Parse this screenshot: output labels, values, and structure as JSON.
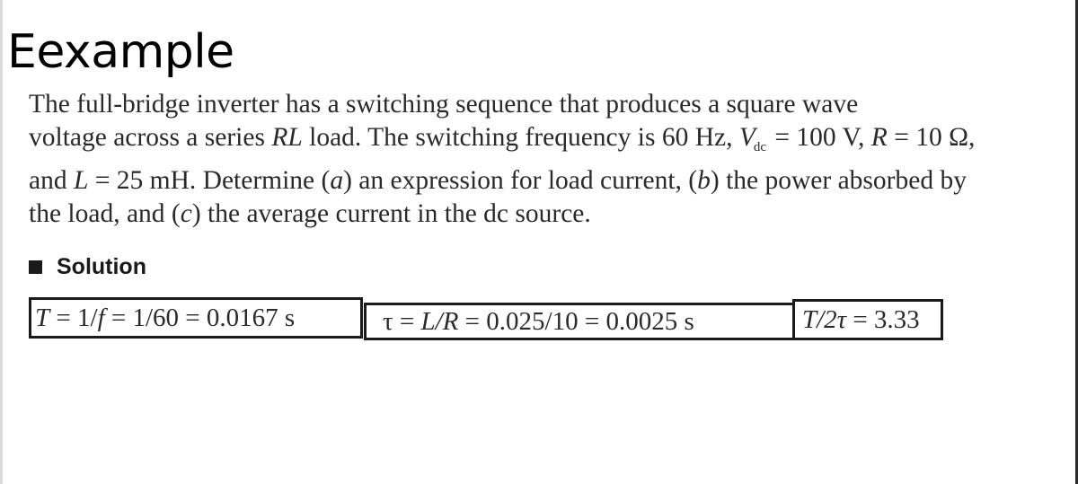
{
  "title": "Eexample",
  "problem": {
    "line1": "The full-bridge inverter has a switching sequence that produces a square wave",
    "line2": {
      "pre": "voltage across a series ",
      "rl": "RL",
      "mid": " load. The switching frequency is 60 Hz, ",
      "v": "V",
      "v_sub": "dc",
      "post_v": " = 100 V, ",
      "r": "R",
      "post_r": " = 10 Ω,"
    },
    "line3": {
      "pre": "and ",
      "l": "L",
      "mid": " = 25 mH. Determine (",
      "a": "a",
      "mid2": ") an expression for load current, (",
      "b": "b",
      "post": ") the power absorbed by"
    },
    "line4": {
      "pre": "the load, and (",
      "c": "c",
      "post": ") the average current in the dc source."
    }
  },
  "solution": {
    "heading": "Solution",
    "equations": [
      {
        "var": "T",
        "rest1": " = 1/",
        "f": "f",
        "rest2": " = 1/60 = 0.0167 s"
      },
      {
        "tau": "τ",
        "eq1": " = ",
        "lr": "L/R",
        "rest": " = 0.025/10 = 0.0025 s"
      },
      {
        "t2tau": "T/2τ",
        "rest": " = 3.33"
      }
    ]
  }
}
